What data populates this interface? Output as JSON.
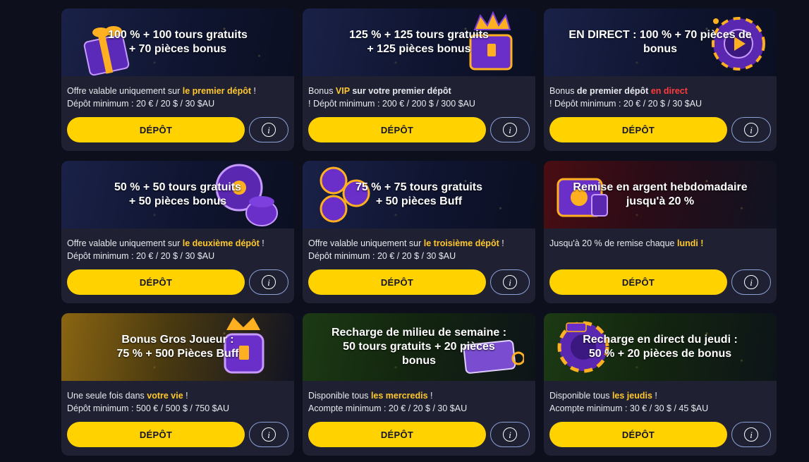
{
  "bonuses": [
    {
      "title": "100 % + 100 tours gratuits\n+ 70 pièces bonus",
      "line1": [
        {
          "t": "Offre valable uniquement sur ",
          "s": ""
        },
        {
          "t": "le premier dépôt",
          "s": "hl-y"
        },
        {
          "t": " !",
          "s": ""
        }
      ],
      "line2": "Dépôt minimum : 20 € / 20 $ / 30 $AU",
      "button": "DÉPÔT",
      "theme": "navy",
      "art": "gift-box-icon"
    },
    {
      "title": "125 % + 125 tours gratuits\n+ 125 pièces bonus",
      "line1": [
        {
          "t": "Bonus ",
          "s": ""
        },
        {
          "t": "VIP",
          "s": "hl-y"
        },
        {
          "t": " sur votre premier dépôt",
          "s": "b"
        }
      ],
      "line2": " ! Dépôt minimum : 200 € / 200 $ / 300 $AU",
      "button": "DÉPÔT",
      "theme": "navy",
      "art": "treasure-chest-crown-icon"
    },
    {
      "title": "EN DIRECT : 100 % + 70 pièces de\nbonus",
      "line1": [
        {
          "t": "Bonus ",
          "s": ""
        },
        {
          "t": "de premier dépôt",
          "s": "b"
        },
        {
          "t": " en direct",
          "s": "hl-r"
        }
      ],
      "line2": " ! Dépôt minimum : 20 € / 20 $ / 30 $AU",
      "button": "DÉPÔT",
      "theme": "navy",
      "art": "casino-chip-icon"
    },
    {
      "title": "50 % + 50 tours gratuits\n+ 50 pièces bonus",
      "line1": [
        {
          "t": "Offre valable uniquement sur ",
          "s": ""
        },
        {
          "t": "le deuxième dépôt",
          "s": "hl-y"
        },
        {
          "t": " !",
          "s": ""
        }
      ],
      "line2": "Dépôt minimum : 20 € / 20 $ / 30 $AU",
      "button": "DÉPÔT",
      "theme": "navy",
      "art": "fortune-wheel-icon"
    },
    {
      "title": "75 % + 75 tours gratuits\n+ 50 pièces Buff",
      "line1": [
        {
          "t": "Offre valable uniquement sur ",
          "s": ""
        },
        {
          "t": "le troisième dépôt",
          "s": "hl-y"
        },
        {
          "t": " !",
          "s": ""
        }
      ],
      "line2": "Dépôt minimum : 20 € / 20 $ / 30 $AU",
      "button": "DÉPÔT",
      "theme": "navy",
      "art": "multiplier-chips-icon"
    },
    {
      "title": "Remise en argent hebdomadaire\njusqu'à 20 %",
      "line1": [
        {
          "t": "Jusqu'à 20 % de remise chaque ",
          "s": ""
        },
        {
          "t": "lundi !",
          "s": "hl-y"
        }
      ],
      "line2": "",
      "button": "DÉPÔT",
      "theme": "red",
      "art": "cashback-chest-icon"
    },
    {
      "title": "Bonus Gros Joueur :\n75 % + 500 Pièces Buff",
      "line1": [
        {
          "t": "Une seule fois dans ",
          "s": ""
        },
        {
          "t": "votre vie",
          "s": "hl-y"
        },
        {
          "t": " !",
          "s": ""
        }
      ],
      "line2": "Dépôt minimum : 500 € / 500 $ / 750 $AU",
      "button": "DÉPÔT",
      "theme": "gold",
      "art": "crown-trophy-icon"
    },
    {
      "title": "Recharge de milieu de semaine :\n50 tours gratuits + 20 pièces\nbonus",
      "line1": [
        {
          "t": "Disponible tous ",
          "s": ""
        },
        {
          "t": "les mercredis",
          "s": "hl-y"
        },
        {
          "t": " !",
          "s": ""
        }
      ],
      "line2": "Acompte minimum : 20 € / 20 $ / 30 $AU",
      "button": "DÉPÔT",
      "theme": "green",
      "art": "wednesday-ticket-icon"
    },
    {
      "title": "Recharge en direct du jeudi :\n50 % + 20 pièces de bonus",
      "line1": [
        {
          "t": "Disponible tous ",
          "s": ""
        },
        {
          "t": "les jeudis",
          "s": "hl-y"
        },
        {
          "t": " !",
          "s": ""
        }
      ],
      "line2": "Acompte minimum : 30 € / 30 $ / 45 $AU",
      "button": "DÉPÔT",
      "theme": "green",
      "art": "live-chip-icon"
    }
  ],
  "info_symbol": "i",
  "colors": {
    "accent_yellow": "#ffd200",
    "highlight_yellow": "#ffc82a",
    "highlight_red": "#ff3b3b",
    "card_bg": "#1f2133",
    "page_bg": "#0e0f1c"
  }
}
